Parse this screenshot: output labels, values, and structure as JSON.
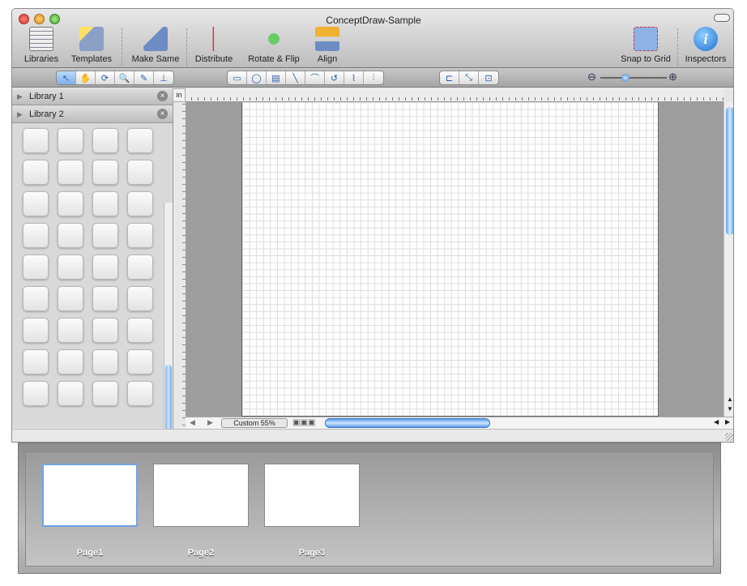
{
  "window": {
    "title": "ConceptDraw-Sample"
  },
  "toolbar": {
    "items": [
      {
        "label": "Libraries",
        "icon": "libraries-icon"
      },
      {
        "label": "Templates",
        "icon": "templates-icon"
      },
      {
        "label": "Make Same",
        "icon": "make-same-icon"
      },
      {
        "label": "Distribute",
        "icon": "distribute-icon"
      },
      {
        "label": "Rotate & Flip",
        "icon": "rotate-flip-icon"
      },
      {
        "label": "Align",
        "icon": "align-icon"
      },
      {
        "label": "Snap to Grid",
        "icon": "snap-grid-icon"
      },
      {
        "label": "Inspectors",
        "icon": "inspectors-icon"
      }
    ]
  },
  "tools": {
    "pointer": "↖",
    "hand": "✋",
    "rotate": "⟳",
    "zoom": "🔍",
    "eyedropper": "✎",
    "stamp": "⊥",
    "rect": "▭",
    "ellipse": "◯",
    "text": "▤",
    "line": "╲",
    "arc": "⌒",
    "curve": "↺",
    "bezier": "⌇",
    "connector": "⫶",
    "conn1": "⊏",
    "conn2": "⤡",
    "conn3": "⊡",
    "zoom_out": "⊖",
    "zoom_in": "⊕"
  },
  "libraries": [
    {
      "name": "Library 1"
    },
    {
      "name": "Library 2"
    }
  ],
  "library_bar": [
    "+□",
    "+▥",
    "−▥",
    "⁻▥",
    "▤",
    "||"
  ],
  "ruler": {
    "unit": "in"
  },
  "canvas": {
    "zoom": "Custom 55%"
  },
  "pages": [
    {
      "name": "Page1",
      "selected": true
    },
    {
      "name": "Page2",
      "selected": false
    },
    {
      "name": "Page3",
      "selected": false
    }
  ]
}
